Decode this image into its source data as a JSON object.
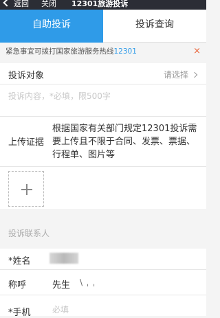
{
  "navbar": {
    "back_label": "返回",
    "close_label": "关闭",
    "title": "12301旅游投诉"
  },
  "tabs": [
    {
      "label": "自助投诉",
      "active": true
    },
    {
      "label": "投诉查询",
      "active": false
    }
  ],
  "notice": {
    "text": "紧急事宜可拨打国家旅游服务热线",
    "hotline": "12301",
    "close_icon": "×"
  },
  "form": {
    "target": {
      "label": "投诉对象",
      "select_placeholder": "请选择"
    },
    "content": {
      "placeholder": "投诉内容，*必填，限500字"
    },
    "upload": {
      "label": "上传证据",
      "description": "根据国家有关部门规定12301投诉需要上传且不限于合同、发票、票据、行程单、图片等",
      "add_icon": "plus-icon"
    }
  },
  "contact": {
    "section_title": "投诉联系人",
    "name_label": "*姓名",
    "title_label": "称呼",
    "title_value": "先生",
    "title_marks": "\\ ˌ ˌ",
    "phone_label": "*手机",
    "phone_placeholder": "必填"
  },
  "colors": {
    "accent": "#2f9be8",
    "navbar_bg": "#2b2d35",
    "notice_close": "#e8663c"
  }
}
